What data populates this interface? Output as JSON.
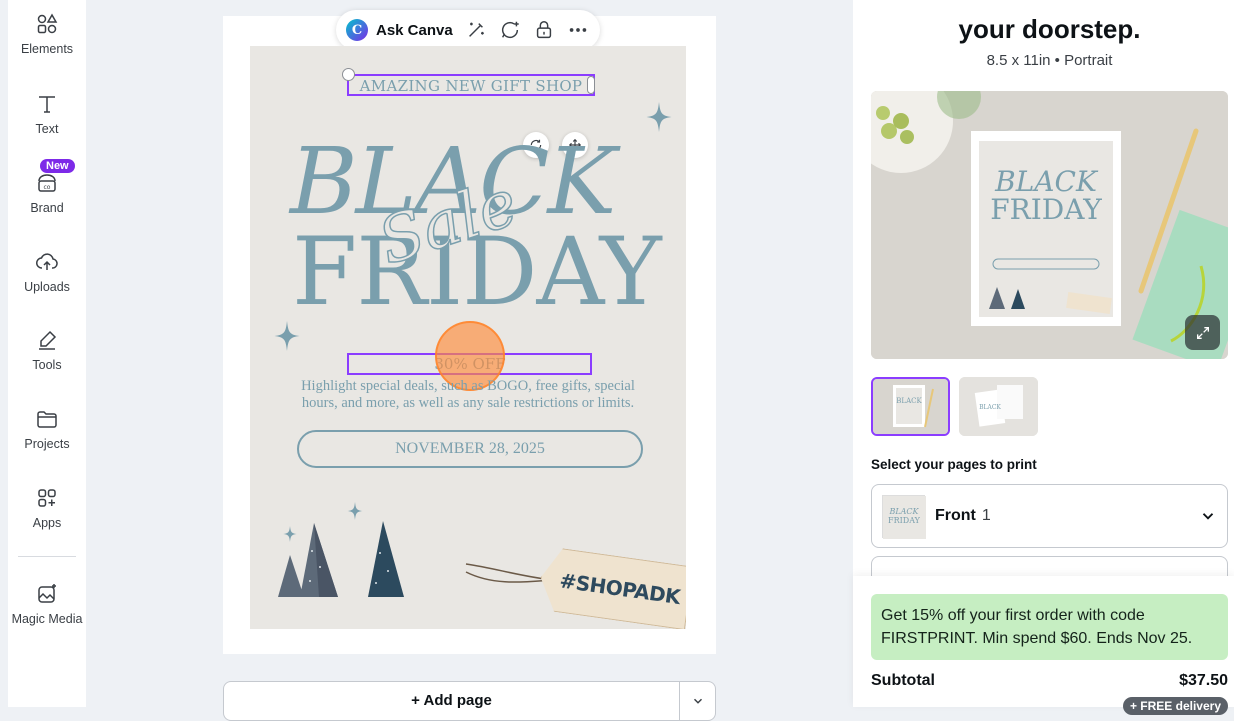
{
  "sidebar": {
    "items": [
      {
        "label": "Elements",
        "icon": "elements-icon"
      },
      {
        "label": "Text",
        "icon": "text-icon"
      },
      {
        "label": "Brand",
        "icon": "brand-icon",
        "badge": "New"
      },
      {
        "label": "Uploads",
        "icon": "uploads-icon"
      },
      {
        "label": "Tools",
        "icon": "tools-icon"
      },
      {
        "label": "Projects",
        "icon": "folder-icon"
      },
      {
        "label": "Apps",
        "icon": "apps-icon"
      },
      {
        "label": "Magic Media",
        "icon": "magic-media-icon"
      }
    ]
  },
  "toolbar": {
    "ask_label": "Ask Canva",
    "icons": [
      "canva-logo-icon",
      "magic-wand-icon",
      "comment-add-icon",
      "lock-icon",
      "more-icon"
    ]
  },
  "design": {
    "gift_shop": "AMAZING NEW GIFT SHOP",
    "headline_1": "BLACK",
    "headline_2": "FRIDAY",
    "script_word": "Sale",
    "offer": "30% OFF",
    "body_line_1": "Highlight special deals, such as BOGO, free gifts, special",
    "body_line_2": "hours, and more, as well as any sale restrictions or limits.",
    "date": "NOVEMBER 28, 2025",
    "tag_text": "#SHOPADK",
    "colors": {
      "accent": "#7a9fad",
      "background": "#e9e7e3",
      "selection": "#8b3dff"
    }
  },
  "canvas": {
    "add_page_label": "+ Add page"
  },
  "print_panel": {
    "title": "your doorstep.",
    "subtitle": "8.5 x 11in • Portrait",
    "select_label": "Select your pages to print",
    "page_select": {
      "label": "Front",
      "count": "1"
    },
    "promo": "Get 15% off your first order with code FIRSTPRINT. Min spend $60. Ends Nov 25.",
    "subtotal_label": "Subtotal",
    "subtotal_value": "$37.50",
    "delivery_badge": "+ FREE delivery",
    "colors": {
      "promo_bg": "#c6eec2",
      "thumb_selected": "#8b3dff"
    }
  }
}
